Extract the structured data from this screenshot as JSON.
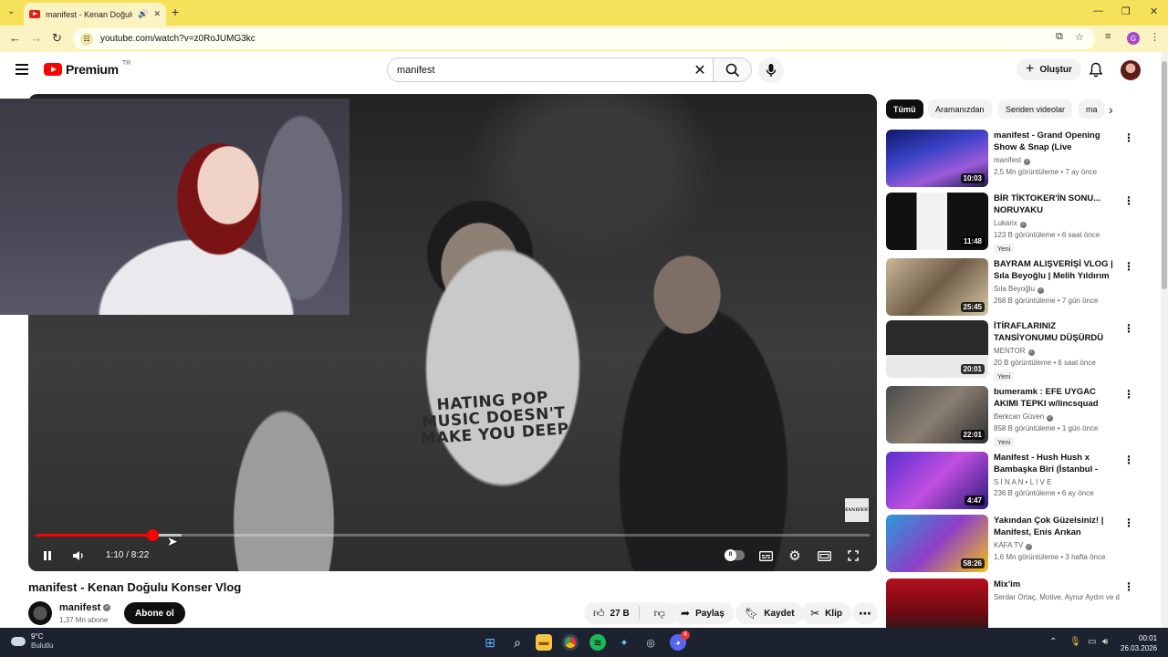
{
  "browser": {
    "tab_title": "manifest - Kenan Doğulu K",
    "url": "youtube.com/watch?v=z0RoJUMG3kc",
    "profile_initial": "G"
  },
  "header": {
    "logo_text": "Premium",
    "logo_region": "TR",
    "search_value": "manifest",
    "create_label": "Oluştur"
  },
  "player": {
    "shirt_text": "HATING POP MUSIC DOESN'T MAKE YOU DEEP",
    "watermark": "MANIFEST",
    "time": "1:10 / 8:22",
    "progress": 0.14,
    "buffered": 0.175
  },
  "video": {
    "title": "manifest - Kenan Doğulu Konser Vlog",
    "channel": "manifest",
    "subscribers": "1,37 Mn abone",
    "subscribe_label": "Abone ol",
    "likes": "27 B",
    "share_label": "Paylaş",
    "save_label": "Kaydet",
    "clip_label": "Klip"
  },
  "sidebar": {
    "chips": [
      "Tümü",
      "Aramanızdan",
      "Seriden videolar",
      "ma"
    ],
    "recommendations": [
      {
        "title": "manifest - Grand Opening Show & Snap (Live Performance) ...",
        "channel": "manifest",
        "verified": true,
        "meta": "2,5 Mn görüntüleme • 7 ay önce",
        "duration": "10:03",
        "badge": ""
      },
      {
        "title": "BİR TİKTOKER'İN SONU... NORUYAKU",
        "channel": "Lukarix",
        "verified": true,
        "meta": "123 B görüntüleme • 6 saat önce",
        "duration": "11:48",
        "badge": "Yeni"
      },
      {
        "title": "BAYRAM ALIŞVERİŞİ VLOG | Sıla Beyoğlu | Melih Yıldırım",
        "channel": "Sıla Beyoğlu",
        "verified": true,
        "meta": "268 B görüntüleme • 7 gün önce",
        "duration": "25:45",
        "badge": ""
      },
      {
        "title": "İTİRAFLARINIZ TANSİYONUMU DÜŞÜRDÜ",
        "channel": "MENTOR",
        "verified": true,
        "meta": "20 B görüntüleme • 6 saat önce",
        "duration": "20:01",
        "badge": "Yeni"
      },
      {
        "title": "bumeramk : EFE UYGAC AKIMI TEPKI w/lincsquad",
        "channel": "Berkcan Güven",
        "verified": true,
        "meta": "858 B görüntüleme • 1 gün önce",
        "duration": "22:01",
        "badge": "Yeni"
      },
      {
        "title": "Manifest - Hush Hush x Bambaşka Biri (İstanbul - Çiftli...",
        "channel": "S İ N A N • L I V E",
        "verified": false,
        "meta": "236 B görüntüleme • 6 ay önce",
        "duration": "4:47",
        "badge": ""
      },
      {
        "title": "Yakından Çok Güzelsiniz! | Manifest, Enis Arıkan",
        "channel": "KAFA TV",
        "verified": true,
        "meta": "1,6 Mn görüntüleme • 3 hafta önce",
        "duration": "58:26",
        "badge": ""
      },
      {
        "title": "Mix'im",
        "channel": "Serdar Ortaç, Motive, Aynur Aydın ve dah...",
        "verified": false,
        "meta": "",
        "duration": "",
        "badge": ""
      }
    ]
  },
  "taskbar": {
    "temperature": "9°C",
    "weather": "Bulutlu",
    "time": "00:01",
    "date": "26.03.2026",
    "discord_badge": "4"
  }
}
